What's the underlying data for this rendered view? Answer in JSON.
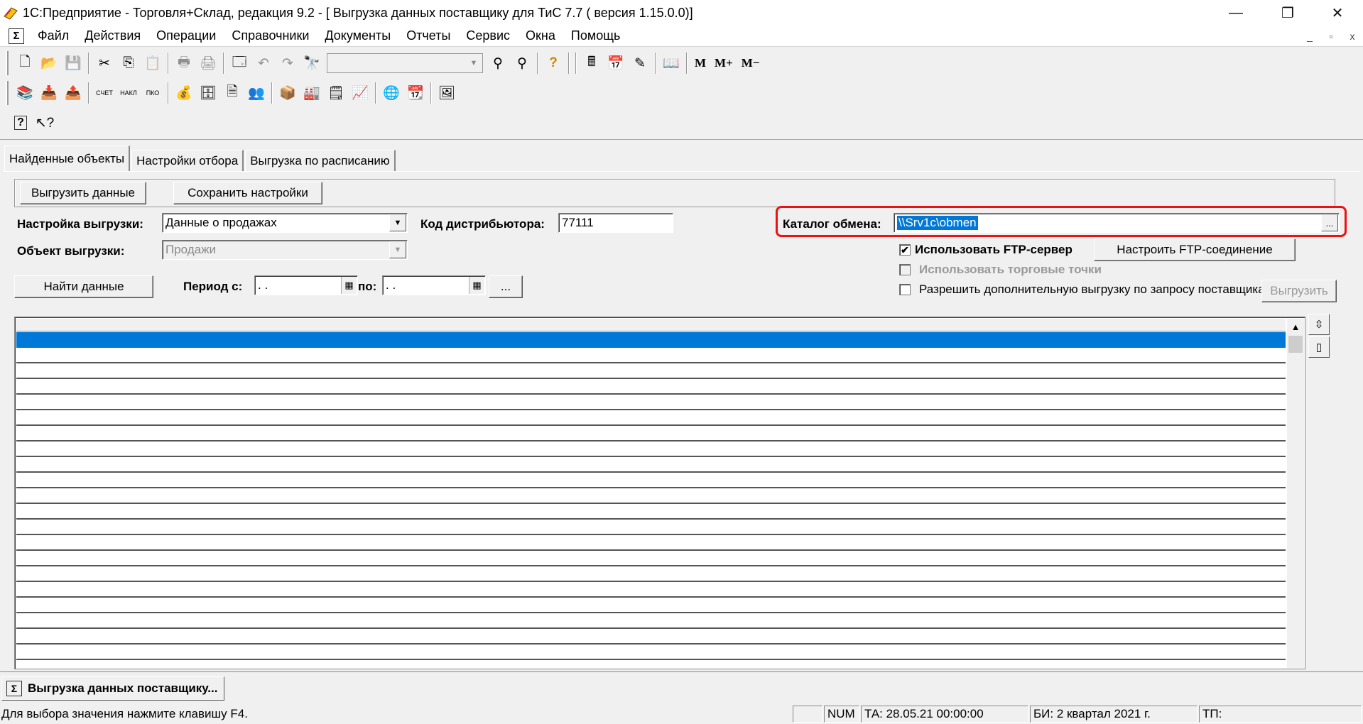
{
  "window": {
    "title": "1С:Предприятие - Торговля+Склад, редакция 9.2 - [ Выгрузка данных поставщику для ТиС 7.7 ( версия 1.15.0.0)]",
    "minimize": "—",
    "restore": "❐",
    "close": "✕"
  },
  "menu": {
    "items": [
      "Файл",
      "Действия",
      "Операции",
      "Справочники",
      "Документы",
      "Отчеты",
      "Сервис",
      "Окна",
      "Помощь"
    ],
    "mdi_minimize": "_",
    "mdi_restore": "▫",
    "mdi_close": "x"
  },
  "toolbar": {
    "m": "M",
    "m_plus": "M+",
    "m_minus": "M−"
  },
  "tabs": [
    "Найденные объекты",
    "Настройки отбора",
    "Выгрузка по расписанию"
  ],
  "form": {
    "export_button": "Выгрузить данные",
    "save_settings_button": "Сохранить настройки",
    "export_setting_label": "Настройка выгрузки:",
    "export_setting_value": "Данные о продажах",
    "distributor_code_label": "Код дистрибьютора:",
    "distributor_code_value": "77111",
    "exchange_dir_label": "Каталог обмена:",
    "exchange_dir_value": "\\\\Srv1c\\obmen",
    "browse_button": "...",
    "export_object_label": "Объект выгрузки:",
    "export_object_value": "Продажи",
    "use_ftp_label": "Использовать FTP-сервер",
    "use_ftp_checked": "✔",
    "configure_ftp_button": "Настроить FTP-соединение",
    "use_outlets_label": "Использовать торговые точки",
    "allow_extra_label": "Разрешить дополнительную выгрузку по запросу поставщика",
    "extra_export_button": "Выгрузить",
    "find_data_button": "Найти данные",
    "period_from_label": "Период с:",
    "period_from_value": " .  .",
    "period_to_label": "по:",
    "period_to_value": " .  .",
    "period_button": "..."
  },
  "windowbar": {
    "tab_label": "Выгрузка данных поставщику..."
  },
  "status": {
    "hint": "Для выбора значения нажмите клавишу F4.",
    "num": "NUM",
    "ta": "ТА: 28.05.21  00:00:00",
    "bi": "БИ: 2 квартал 2021 г.",
    "tp": "ТП:"
  }
}
